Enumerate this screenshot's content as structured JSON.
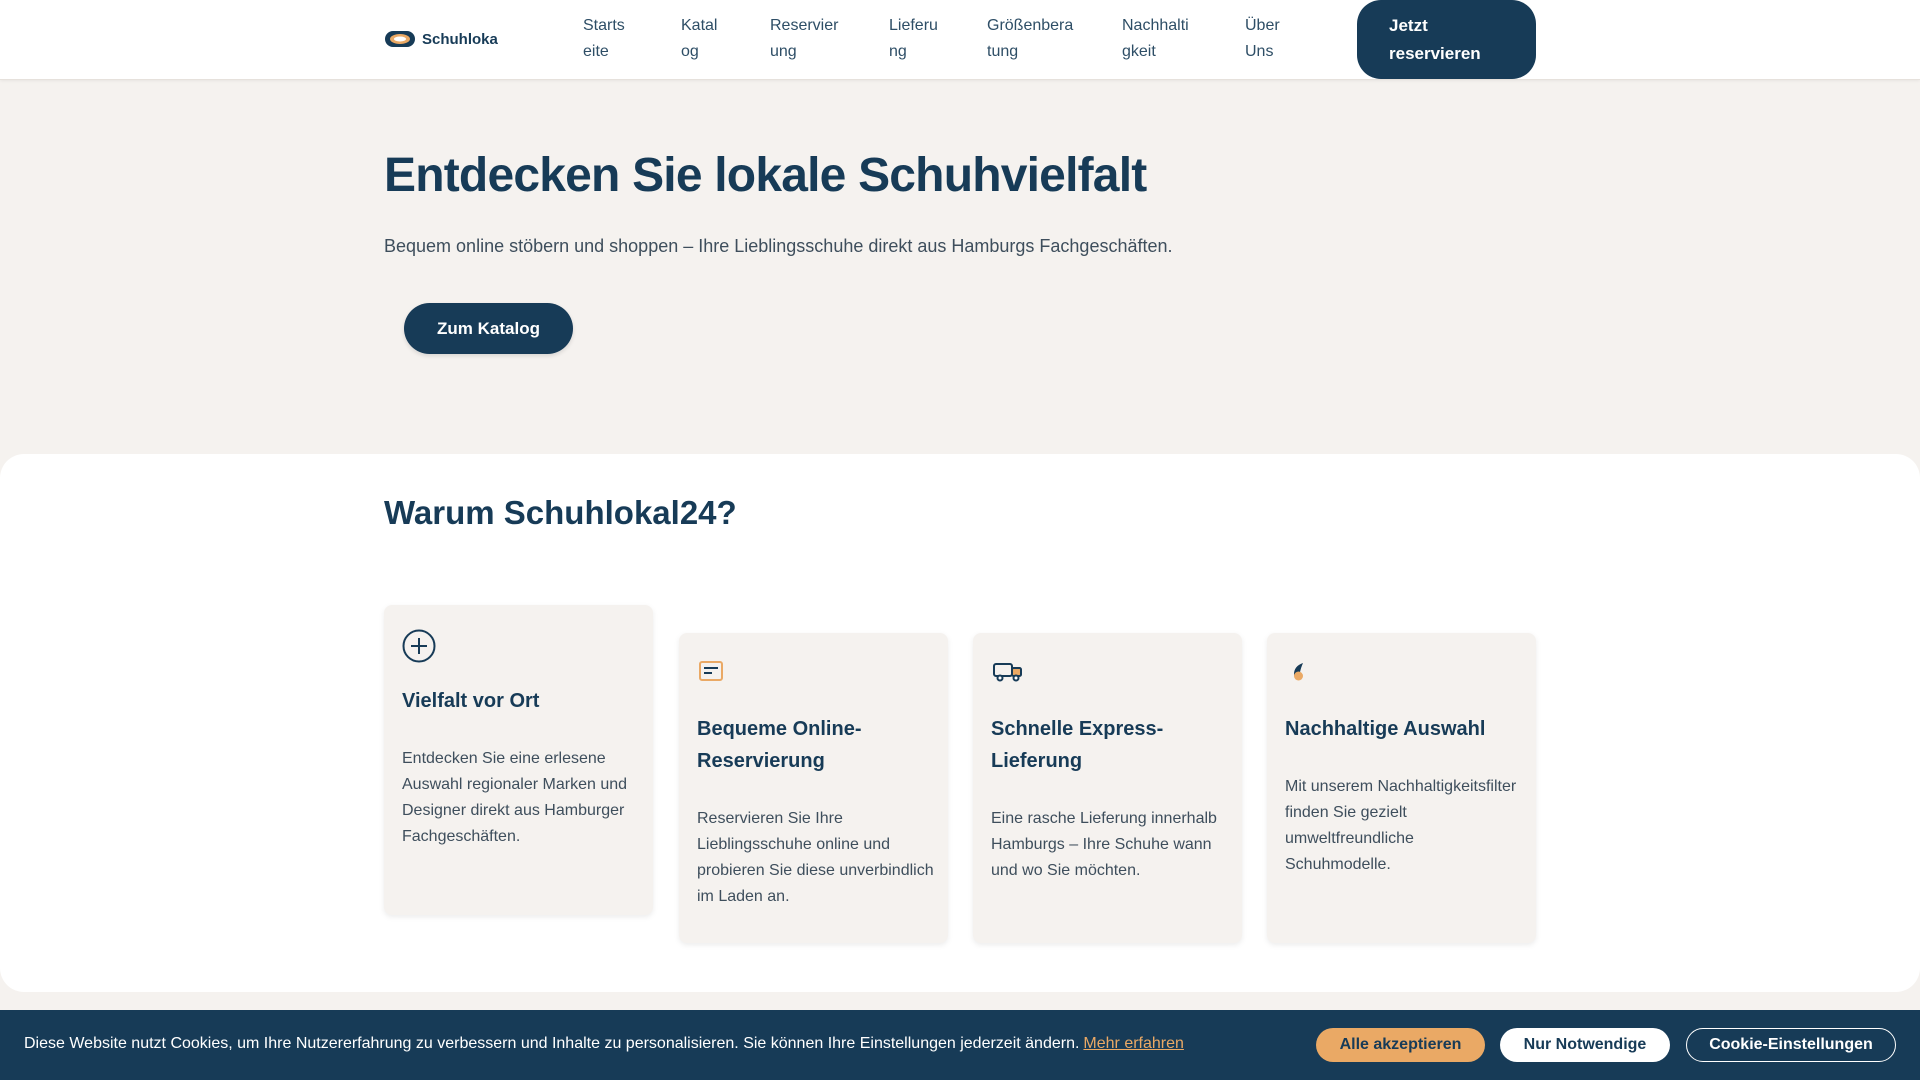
{
  "header": {
    "brand_name": "Schuhloka",
    "nav": [
      {
        "line1": "Starts",
        "line2": "eite"
      },
      {
        "line1": "Katal",
        "line2": "og"
      },
      {
        "line1": "Reservier",
        "line2": "ung"
      },
      {
        "line1": "Lieferu",
        "line2": "ng"
      },
      {
        "line1": "Größenbera",
        "line2": "tung"
      },
      {
        "line1": "Nachhalti",
        "line2": "gkeit"
      },
      {
        "line1": "Über",
        "line2": "Uns"
      }
    ],
    "cta": {
      "line1": "Jetzt",
      "line2": "reservieren"
    }
  },
  "hero": {
    "title": "Entdecken Sie lokale Schuhvielfalt",
    "subtitle": "Bequem online stöbern und shoppen – Ihre Lieblingsschuhe direkt aus Hamburgs Fachgeschäften.",
    "button": "Zum Katalog"
  },
  "features": {
    "title": "Warum Schuhlokal24?",
    "cards": [
      {
        "icon": "plus-circle-icon",
        "title": "Vielfalt vor Ort",
        "text": "Entdecken Sie eine erlesene Auswahl regionaler Marken und Designer direkt aus Hamburger Fachgeschäften."
      },
      {
        "icon": "reservation-card-icon",
        "title": "Bequeme Online-Reservierung",
        "text": "Reservieren Sie Ihre Lieblingsschuhe online und probieren Sie diese unverbindlich im Laden an."
      },
      {
        "icon": "delivery-truck-icon",
        "title": "Schnelle Express-Lieferung",
        "text": "Eine rasche Lieferung innerhalb Hamburgs – Ihre Schuhe wann und wo Sie möchten."
      },
      {
        "icon": "leaf-icon",
        "title": "Nachhaltige Auswahl",
        "text": "Mit unserem Nachhaltigkeitsfilter finden Sie gezielt umweltfreundliche Schuhmodelle."
      }
    ]
  },
  "cookie": {
    "text": "Diese Website nutzt Cookies, um Ihre Nutzererfahrung zu verbessern und Inhalte zu personalisieren. Sie können Ihre Einstellungen jederzeit ändern.",
    "link": "Mehr erfahren",
    "accept": "Alle akzeptieren",
    "necessary": "Nur Notwendige",
    "settings": "Cookie-Einstellungen"
  },
  "colors": {
    "primary": "#173b57",
    "accent": "#eaa965",
    "background": "#f5f2ef"
  }
}
